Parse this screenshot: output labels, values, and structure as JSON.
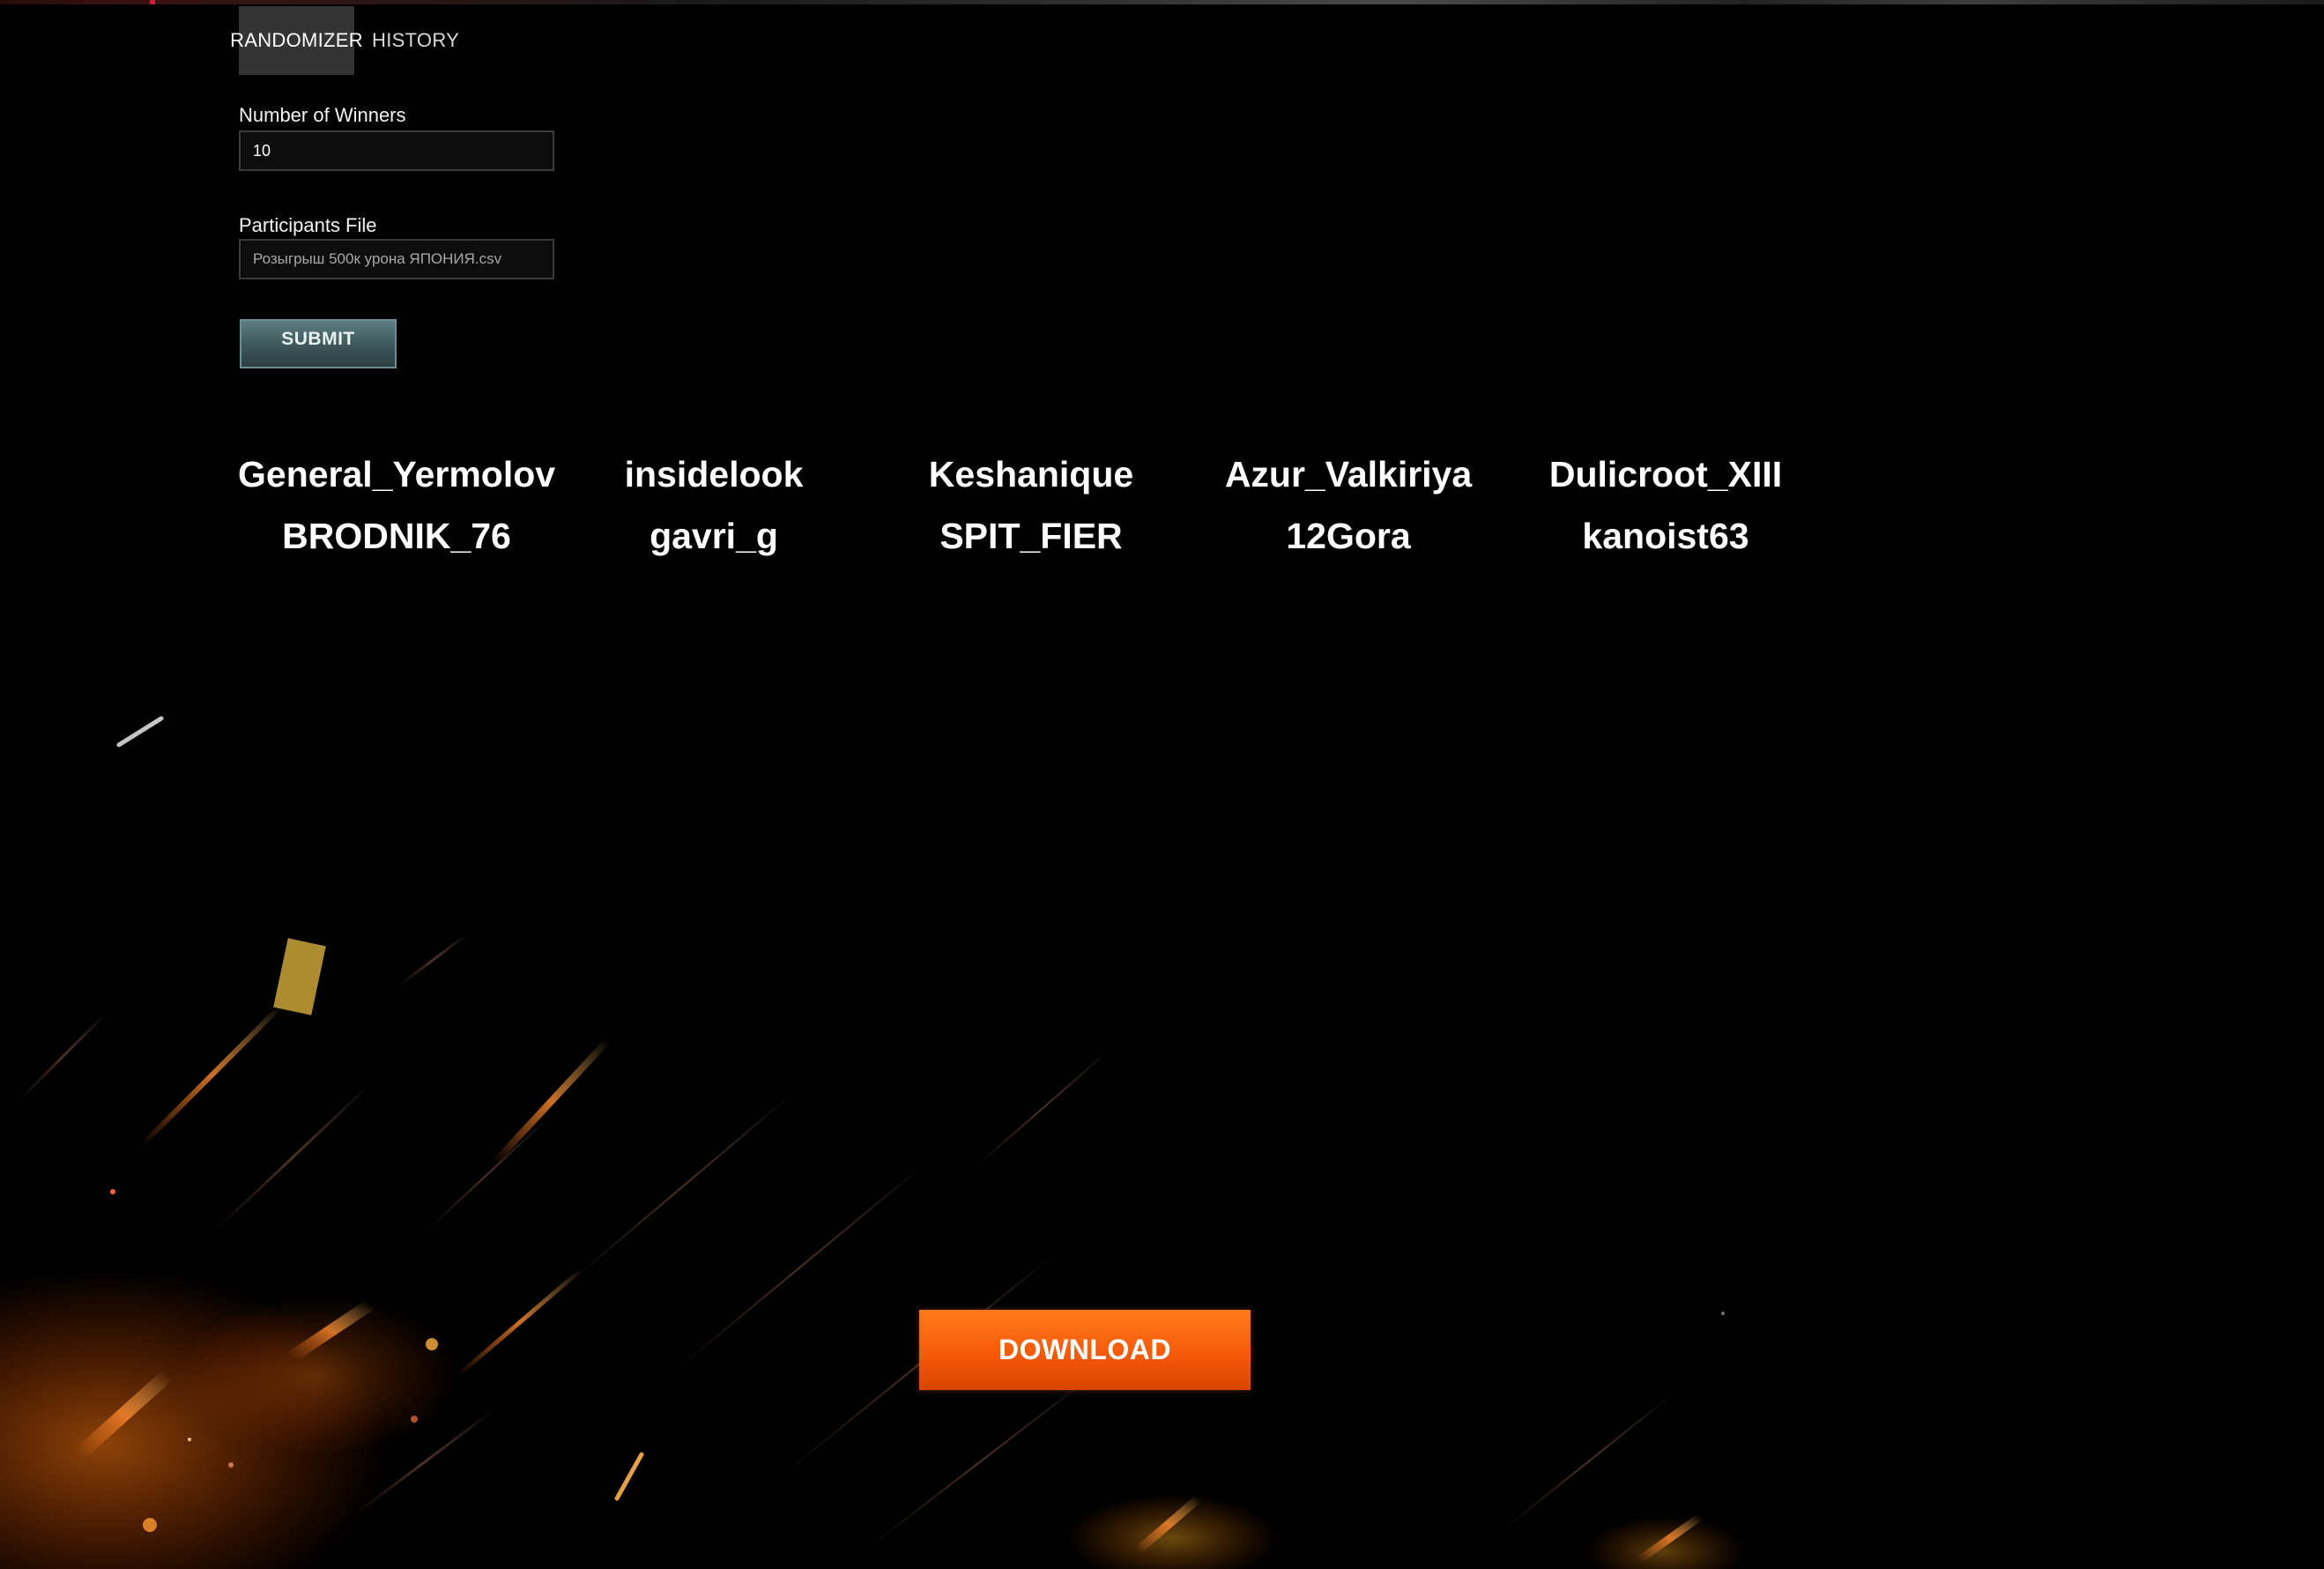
{
  "tabs": [
    {
      "label": "RANDOMIZER",
      "active": true
    },
    {
      "label": "HISTORY",
      "active": false
    }
  ],
  "form": {
    "winners_label": "Number of Winners",
    "winners_value": "10",
    "file_label": "Participants File",
    "file_name": "Розыгрыш 500к урона ЯПОНИЯ.csv",
    "submit_label": "SUBMIT"
  },
  "winners": [
    "General_Yermolov",
    "insidelook",
    "Keshanique",
    "Azur_Valkiriya",
    "Dulicroot_XIII",
    "BRODNIK_76",
    "gavri_g",
    "SPIT_FIER",
    "12Gora",
    "kanoist63"
  ],
  "download_label": "DOWNLOAD",
  "colors": {
    "background": "#000000",
    "tab_active_bg": "#343434",
    "submit_bg": "#3c5659",
    "download_bg": "#f65a0a"
  }
}
